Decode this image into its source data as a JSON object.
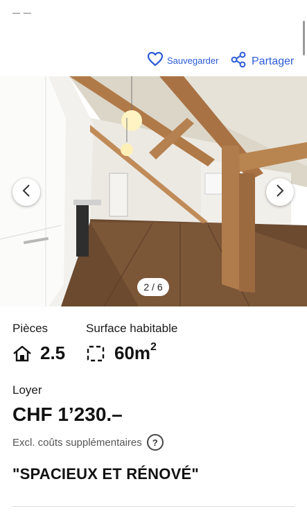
{
  "actions": {
    "save_label": "Sauvegarder",
    "share_label": "Partager",
    "accent_color": "#2b5bd7"
  },
  "gallery": {
    "counter": "2 / 6",
    "prev_icon": "chevron-left-icon",
    "next_icon": "chevron-right-icon"
  },
  "facts": {
    "rooms_label": "Pièces",
    "rooms_value": "2.5",
    "surface_label": "Surface habitable",
    "surface_value": "60m",
    "surface_unit_sup": "2"
  },
  "rent": {
    "label": "Loyer",
    "price": "CHF 1’230.–",
    "note": "Excl. coûts supplémentaires",
    "help_glyph": "?"
  },
  "listing": {
    "headline": "\"SPACIEUX ET RÉNOVÉ\""
  }
}
